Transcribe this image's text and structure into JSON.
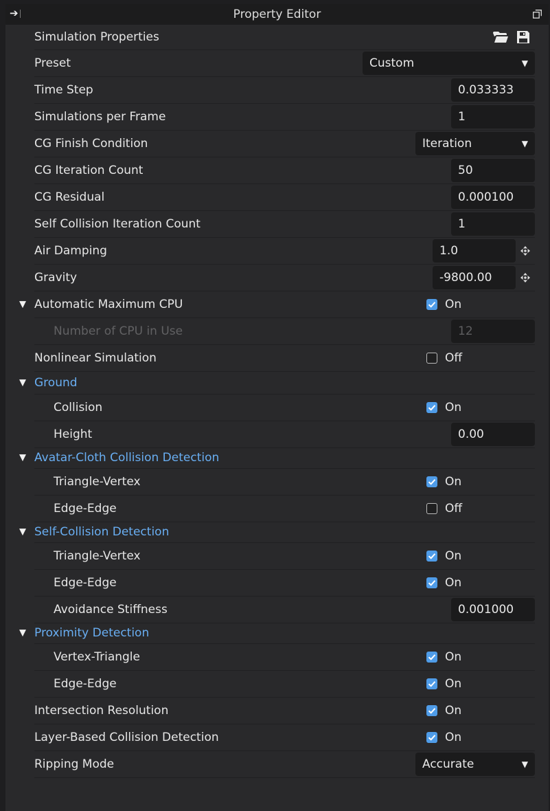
{
  "header": {
    "title": "Property Editor"
  },
  "section": {
    "title": "Simulation Properties"
  },
  "preset": {
    "label": "Preset",
    "value": "Custom"
  },
  "time_step": {
    "label": "Time Step",
    "value": "0.033333"
  },
  "sims_per_frame": {
    "label": "Simulations per Frame",
    "value": "1"
  },
  "cg_finish": {
    "label": "CG Finish Condition",
    "value": "Iteration"
  },
  "cg_iter": {
    "label": "CG Iteration Count",
    "value": "50"
  },
  "cg_residual": {
    "label": "CG Residual",
    "value": "0.000100"
  },
  "self_coll_iter": {
    "label": "Self Collision Iteration Count",
    "value": "1"
  },
  "air_damping": {
    "label": "Air Damping",
    "value": "1.0"
  },
  "gravity": {
    "label": "Gravity",
    "value": "-9800.00"
  },
  "auto_max_cpu": {
    "label": "Automatic Maximum CPU",
    "state": "On"
  },
  "num_cpu": {
    "label": "Number of CPU in Use",
    "value": "12"
  },
  "nonlinear": {
    "label": "Nonlinear Simulation",
    "state": "Off"
  },
  "ground": {
    "title": "Ground",
    "collision": {
      "label": "Collision",
      "state": "On"
    },
    "height": {
      "label": "Height",
      "value": "0.00"
    }
  },
  "avatar_cloth": {
    "title": "Avatar-Cloth Collision Detection",
    "tri_vert": {
      "label": "Triangle-Vertex",
      "state": "On"
    },
    "edge_edge": {
      "label": "Edge-Edge",
      "state": "Off"
    }
  },
  "self_collision": {
    "title": "Self-Collision Detection",
    "tri_vert": {
      "label": "Triangle-Vertex",
      "state": "On"
    },
    "edge_edge": {
      "label": "Edge-Edge",
      "state": "On"
    },
    "avoid_stiff": {
      "label": "Avoidance Stiffness",
      "value": "0.001000"
    }
  },
  "proximity": {
    "title": "Proximity Detection",
    "vert_tri": {
      "label": "Vertex-Triangle",
      "state": "On"
    },
    "edge_edge": {
      "label": "Edge-Edge",
      "state": "On"
    }
  },
  "intersection": {
    "label": "Intersection Resolution",
    "state": "On"
  },
  "layer_based": {
    "label": "Layer-Based Collision Detection",
    "state": "On"
  },
  "ripping": {
    "label": "Ripping Mode",
    "value": "Accurate"
  },
  "colors": {
    "accent": "#4f9ce8",
    "group_title": "#69aef2",
    "panel": "#29292b",
    "field": "#1b1b1c"
  }
}
